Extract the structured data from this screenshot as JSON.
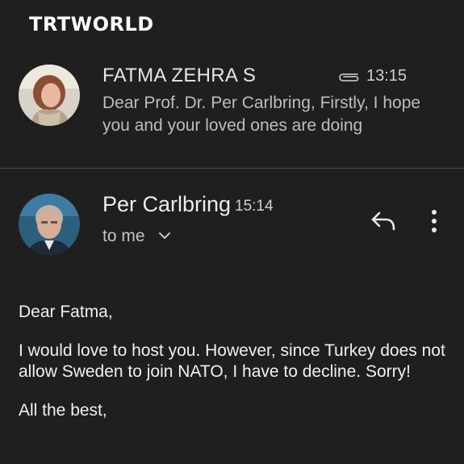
{
  "brand": {
    "logo_text": "TRTWORLD"
  },
  "thread_item": {
    "sender": "FATMA ZEHRA S",
    "time": "13:15",
    "has_attachment": true,
    "snippet": "Dear Prof. Dr. Per Carlbring, Firstly, I hope you and your loved ones are doing"
  },
  "message": {
    "sender": "Per Carlbring",
    "time": "15:14",
    "recipient": "to me",
    "body": {
      "greeting": "Dear Fatma,",
      "paragraph": "I would love to host you. However, since Turkey does not allow Sweden to join NATO, I have to decline. Sorry!",
      "closing": "All the best,"
    }
  },
  "icons": {
    "attachment": "paperclip-icon",
    "expand": "chevron-down-icon",
    "reply": "reply-icon",
    "more": "more-vert-icon"
  },
  "colors": {
    "background": "#1f1f1f",
    "text_primary": "#e8e8e8",
    "text_secondary": "#bdbdbd",
    "divider": "#474747"
  }
}
